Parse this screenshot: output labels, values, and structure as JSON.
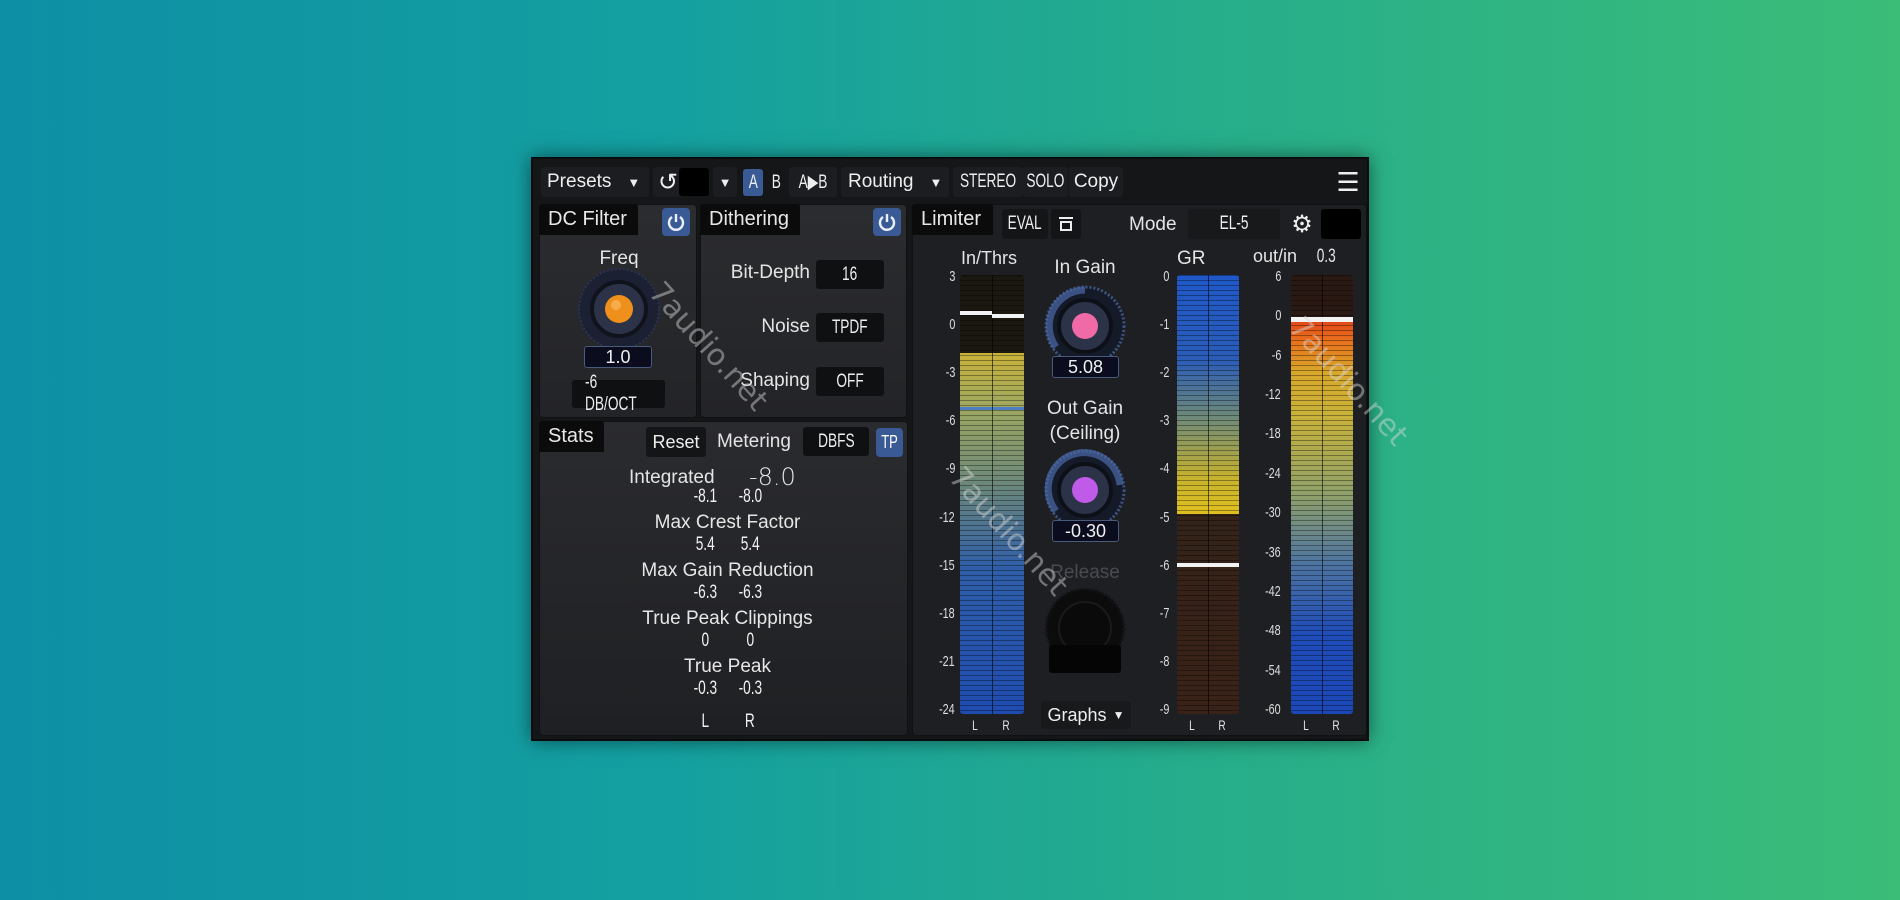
{
  "toolbar": {
    "presets_label": "Presets",
    "undo_icon": "undo-icon",
    "ab_a": "A",
    "ab_b": "B",
    "ab_copy": "A▶B",
    "routing_label": "Routing",
    "stereo_label": "STEREO",
    "solo_label": "SOLO",
    "copy_label": "Copy",
    "menu_icon": "hamburger-icon",
    "active_ab": "A"
  },
  "dc_filter": {
    "title": "DC Filter",
    "enabled": true,
    "freq_label": "Freq",
    "freq_value": "1.0",
    "slope": "-6 DB/OCT",
    "knob_color": "#f0901c"
  },
  "dithering": {
    "title": "Dithering",
    "enabled": true,
    "bit_depth_label": "Bit-Depth",
    "bit_depth_value": "16",
    "noise_label": "Noise",
    "noise_value": "TPDF",
    "shaping_label": "Shaping",
    "shaping_value": "OFF"
  },
  "stats": {
    "title": "Stats",
    "reset_label": "Reset",
    "metering_label": "Metering",
    "metering_value": "DBFS",
    "tp_label": "TP",
    "integrated_label": "Integrated",
    "integrated_value": "-8.0",
    "rows": [
      {
        "label": "",
        "l": "-8.1",
        "r": "-8.0"
      },
      {
        "label": "Max Crest Factor",
        "l": "5.4",
        "r": "5.4"
      },
      {
        "label": "Max Gain Reduction",
        "l": "-6.3",
        "r": "-6.3"
      },
      {
        "label": "True Peak Clippings",
        "l": "0",
        "r": "0"
      },
      {
        "label": "True Peak",
        "l": "-0.3",
        "r": "-0.3"
      }
    ],
    "l_label": "L",
    "r_label": "R"
  },
  "limiter": {
    "title": "Limiter",
    "eval_label": "EVAL",
    "mode_label": "Mode",
    "mode_value": "EL-5",
    "in_thrs_label": "In/Thrs",
    "in_gain_label": "In Gain",
    "in_gain_value": "5.08",
    "out_gain_label": "Out Gain",
    "out_gain_sub": "(Ceiling)",
    "out_gain_value": "-0.30",
    "release_label": "Release",
    "graphs_label": "Graphs",
    "gr_label": "GR",
    "outin_label": "out/in",
    "outin_value": "0.3",
    "in_scale": [
      "3",
      "0",
      "-3",
      "-6",
      "-9",
      "-12",
      "-15",
      "-18",
      "-21",
      "-24"
    ],
    "gr_scale": [
      "0",
      "-1",
      "-2",
      "-3",
      "-4",
      "-5",
      "-6",
      "-7",
      "-8",
      "-9"
    ],
    "out_scale": [
      "6",
      "0",
      "-6",
      "-12",
      "-18",
      "-24",
      "-30",
      "-36",
      "-42",
      "-48",
      "-54",
      "-60"
    ],
    "l_label": "L",
    "r_label": "R",
    "in_gain_knob_color": "#f06aa8",
    "out_gain_knob_color": "#c05ae8",
    "meters": {
      "in_range_db": [
        -24,
        3
      ],
      "in_peak_l_db": 0.8,
      "in_peak_r_db": 0.6,
      "in_level_db": -1.8,
      "threshold_db": -5.1,
      "gr_range_db": [
        -9,
        0
      ],
      "gr_fill_db": -4.9,
      "gr_max_db": -5.9,
      "out_range_db": [
        -60,
        6
      ],
      "out_peak_db": -0.3
    }
  },
  "watermark": "7audio.net"
}
